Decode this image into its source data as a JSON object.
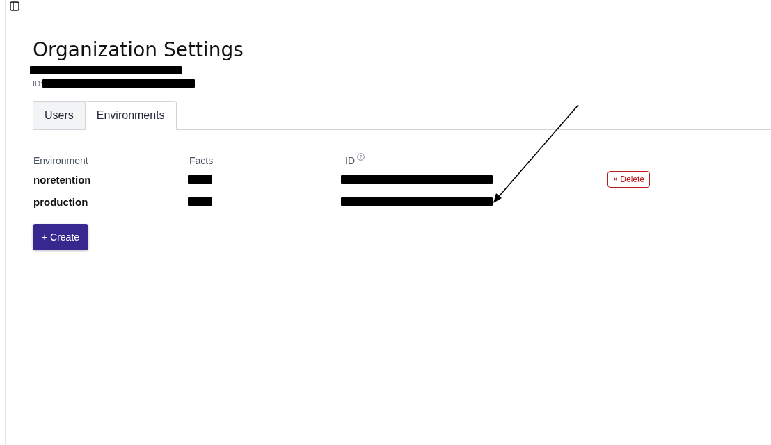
{
  "page": {
    "title": "Organization Settings"
  },
  "organization": {
    "name_redacted": true,
    "id_label": "ID:",
    "id_redacted": true
  },
  "tabs": [
    {
      "label": "Users",
      "selected": false
    },
    {
      "label": "Environments",
      "selected": true
    }
  ],
  "table": {
    "columns": [
      "Environment",
      "Facts",
      "ID"
    ],
    "rows": [
      {
        "environment": "noretention",
        "facts_redacted": true,
        "id_redacted": true,
        "action": "× Delete"
      },
      {
        "environment": "production",
        "facts_redacted": true,
        "id_redacted": true
      }
    ]
  },
  "create_button": "+ Create",
  "annotation": {
    "kind": "arrow"
  }
}
